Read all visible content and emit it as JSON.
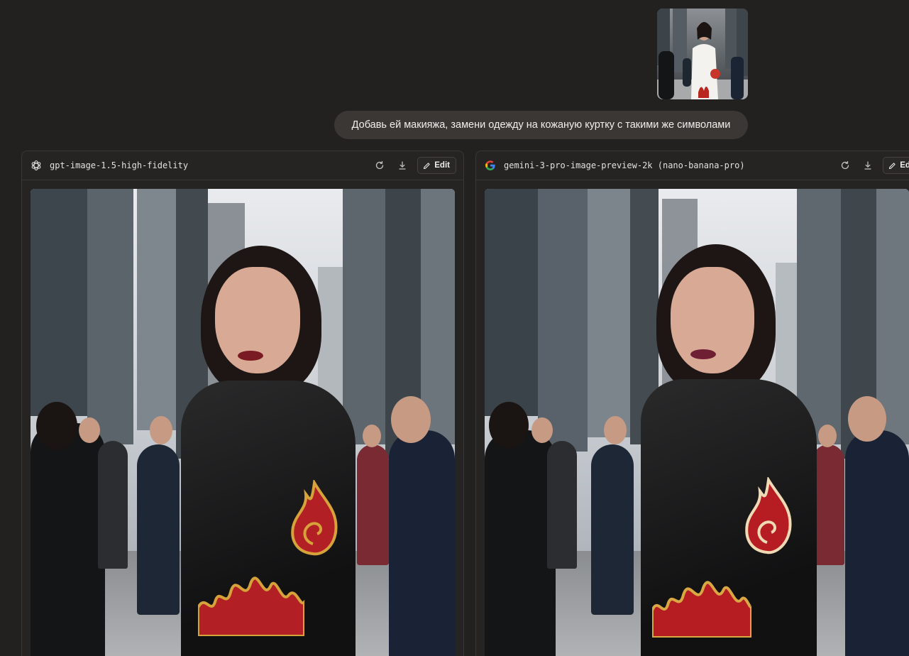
{
  "user_message": {
    "attachment_icon": "image-thumbnail",
    "text": "Добавь ей макияжа, замени одежду на кожаную куртку с такими же символами"
  },
  "responses": [
    {
      "model_icon": "openai-logo-icon",
      "model_name": "gpt-image-1.5-high-fidelity",
      "actions": {
        "regenerate_icon": "refresh-icon",
        "download_icon": "download-icon",
        "edit_label": "Edit"
      }
    },
    {
      "model_icon": "google-logo-icon",
      "model_name": "gemini-3-pro-image-preview-2k (nano-banana-pro)",
      "actions": {
        "regenerate_icon": "refresh-icon",
        "download_icon": "download-icon",
        "edit_label": "Edit"
      }
    }
  ],
  "colors": {
    "background": "#222120",
    "bubble": "#3a3735",
    "panel_border": "#3a3836"
  }
}
